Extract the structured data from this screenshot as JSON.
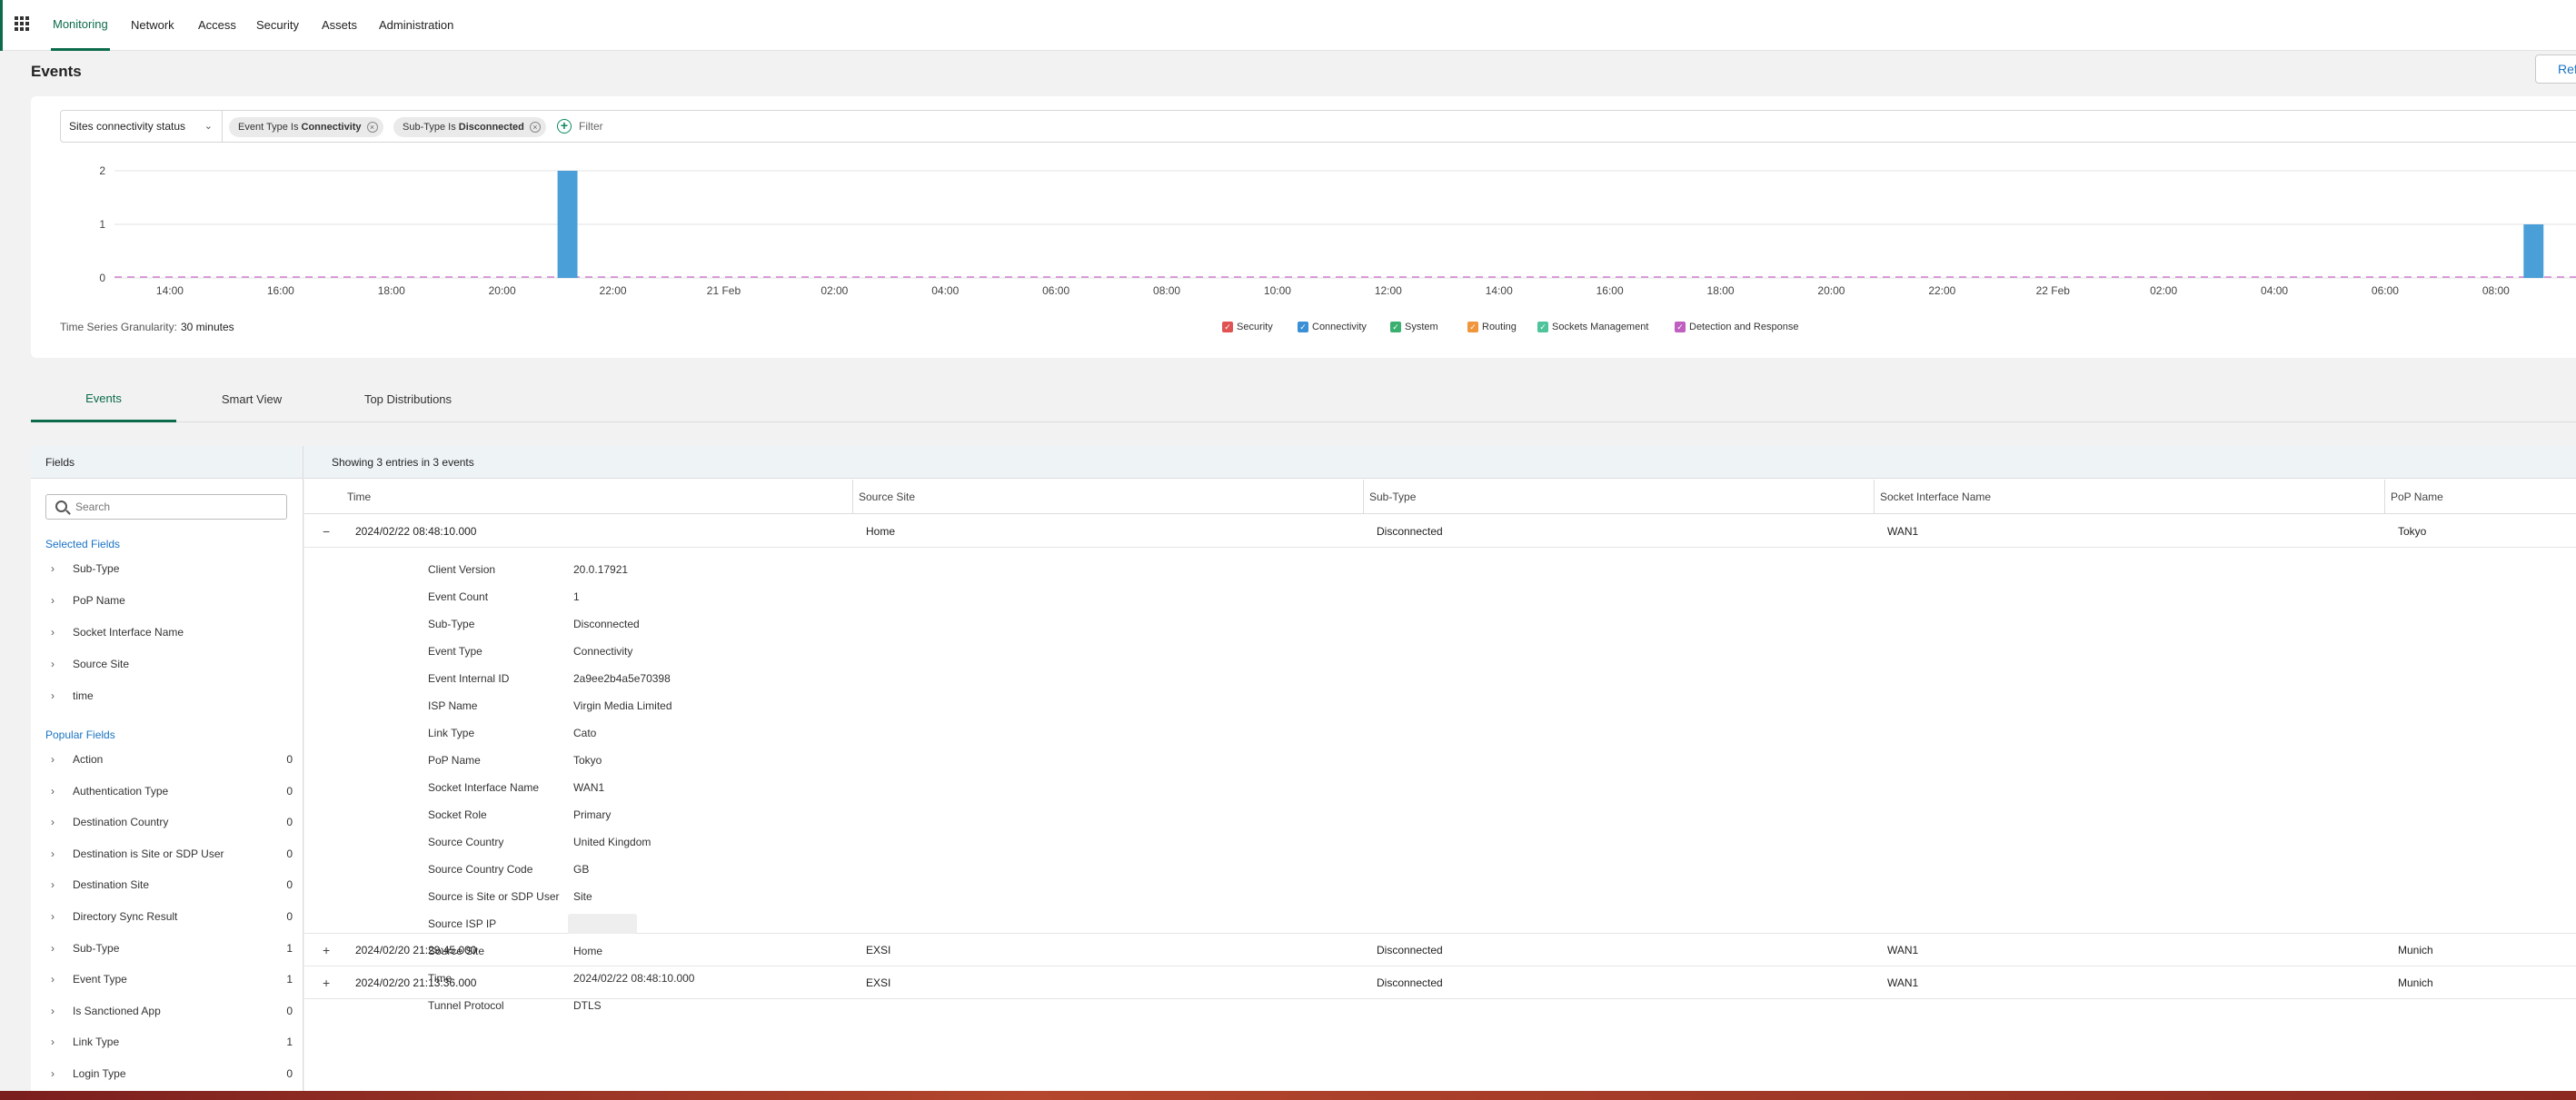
{
  "nav": {
    "items": [
      "Monitoring",
      "Network",
      "Access",
      "Security",
      "Assets",
      "Administration"
    ],
    "active": "Monitoring"
  },
  "page": {
    "title": "Events",
    "refresh_label": "Ref"
  },
  "filter": {
    "dropdown": "Sites connectivity status",
    "chips": [
      {
        "key": "Event Type Is ",
        "value": "Connectivity"
      },
      {
        "key": "Sub-Type Is ",
        "value": "Disconnected"
      }
    ],
    "placeholder": "Filter"
  },
  "chart_data": {
    "type": "bar",
    "title": "",
    "xlabel": "",
    "ylabel": "",
    "ylim": [
      0,
      2
    ],
    "y_ticks": [
      0,
      1,
      2
    ],
    "x_ticks": [
      "14:00",
      "16:00",
      "18:00",
      "20:00",
      "22:00",
      "21 Feb",
      "02:00",
      "04:00",
      "06:00",
      "08:00",
      "10:00",
      "12:00",
      "14:00",
      "16:00",
      "18:00",
      "20:00",
      "22:00",
      "22 Feb",
      "02:00",
      "04:00",
      "06:00",
      "08:00"
    ],
    "x_start": "2024-02-20 13:00",
    "bin_minutes": 30,
    "points": [
      {
        "time": "2024-02-20 21:00",
        "value": 2
      },
      {
        "time": "2024-02-22 08:30",
        "value": 1
      }
    ],
    "series_color": "#4a9fd8",
    "baseline_color": "#d07fd0",
    "grid": true
  },
  "granularity": {
    "label": "Time Series Granularity:",
    "value": "30 minutes"
  },
  "legend": [
    {
      "name": "Security",
      "color": "#e05353"
    },
    {
      "name": "Connectivity",
      "color": "#3a8fd6"
    },
    {
      "name": "System",
      "color": "#3ab070"
    },
    {
      "name": "Routing",
      "color": "#f0953a"
    },
    {
      "name": "Sockets Management",
      "color": "#4fc39a"
    },
    {
      "name": "Detection and Response",
      "color": "#c05fc0"
    }
  ],
  "tabs": [
    "Events",
    "Smart View",
    "Top Distributions"
  ],
  "fields": {
    "title": "Fields",
    "search_placeholder": "Search",
    "selected_title": "Selected Fields",
    "selected": [
      "Sub-Type",
      "PoP Name",
      "Socket Interface Name",
      "Source Site",
      "time"
    ],
    "popular_title": "Popular Fields",
    "popular": [
      {
        "name": "Action",
        "count": "0"
      },
      {
        "name": "Authentication Type",
        "count": "0"
      },
      {
        "name": "Destination Country",
        "count": "0"
      },
      {
        "name": "Destination is Site or SDP User",
        "count": "0"
      },
      {
        "name": "Destination Site",
        "count": "0"
      },
      {
        "name": "Directory Sync Result",
        "count": "0"
      },
      {
        "name": "Sub-Type",
        "count": "1"
      },
      {
        "name": "Event Type",
        "count": "1"
      },
      {
        "name": "Is Sanctioned App",
        "count": "0"
      },
      {
        "name": "Link Type",
        "count": "1"
      },
      {
        "name": "Login Type",
        "count": "0"
      }
    ]
  },
  "events": {
    "summary": "Showing 3 entries in 3 events",
    "columns": [
      "Time",
      "Source Site",
      "Sub-Type",
      "Socket Interface Name",
      "PoP Name"
    ],
    "rows": [
      {
        "toggle": "−",
        "time": "2024/02/22 08:48:10.000",
        "site": "Home",
        "subtype": "Disconnected",
        "iface": "WAN1",
        "pop": "Tokyo"
      },
      {
        "toggle": "+",
        "time": "2024/02/20 21:29:45.000",
        "site": "EXSI",
        "subtype": "Disconnected",
        "iface": "WAN1",
        "pop": "Munich"
      },
      {
        "toggle": "+",
        "time": "2024/02/20 21:13:36.000",
        "site": "EXSI",
        "subtype": "Disconnected",
        "iface": "WAN1",
        "pop": "Munich"
      }
    ],
    "detail": [
      {
        "k": "Client Version",
        "v": "20.0.17921"
      },
      {
        "k": "Event Count",
        "v": "1"
      },
      {
        "k": "Sub-Type",
        "v": "Disconnected"
      },
      {
        "k": "Event Type",
        "v": "Connectivity"
      },
      {
        "k": "Event Internal ID",
        "v": "2a9ee2b4a5e70398"
      },
      {
        "k": "ISP Name",
        "v": "Virgin Media Limited"
      },
      {
        "k": "Link Type",
        "v": "Cato"
      },
      {
        "k": "PoP Name",
        "v": "Tokyo"
      },
      {
        "k": "Socket Interface Name",
        "v": "WAN1"
      },
      {
        "k": "Socket Role",
        "v": "Primary"
      },
      {
        "k": "Source Country",
        "v": "United Kingdom"
      },
      {
        "k": "Source Country Code",
        "v": "GB"
      },
      {
        "k": "Source is Site or SDP User",
        "v": "Site"
      },
      {
        "k": "Source ISP IP",
        "v": ""
      },
      {
        "k": "Source Site",
        "v": "Home"
      },
      {
        "k": "Time",
        "v": "2024/02/22 08:48:10.000"
      },
      {
        "k": "Tunnel Protocol",
        "v": "DTLS"
      }
    ]
  }
}
